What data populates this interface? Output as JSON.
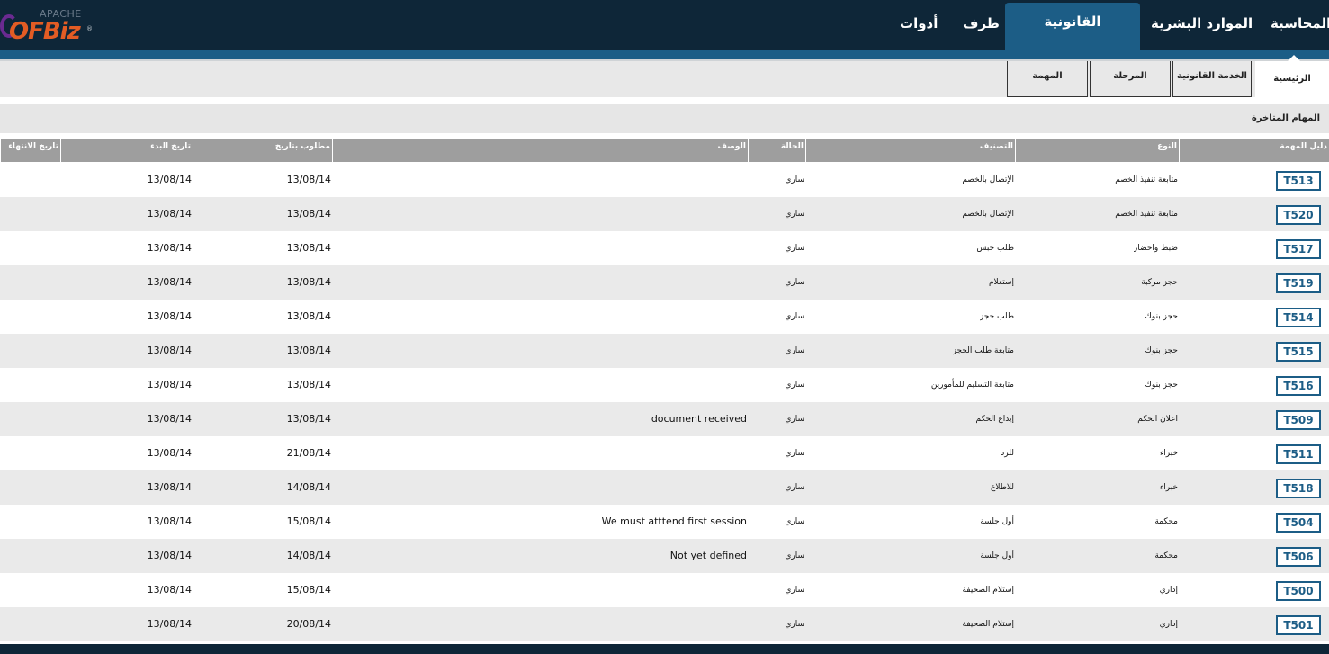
{
  "logo": {
    "top_text": "APACHE",
    "main_text": "OFBiz",
    "mark": "®"
  },
  "nav": {
    "items": [
      {
        "label": "المحاسبة",
        "active": false
      },
      {
        "label": "الموارد البشرية",
        "active": false
      },
      {
        "label": "القانونية",
        "active": true
      },
      {
        "label": "طرف",
        "active": false
      },
      {
        "label": "أدوات",
        "active": false
      }
    ]
  },
  "subtabs": [
    {
      "label": "الرئيسية",
      "active": true
    },
    {
      "label": "الخدمة القانونية",
      "active": false
    },
    {
      "label": "المرحلة",
      "active": false
    },
    {
      "label": "المهمة",
      "active": false
    }
  ],
  "panel": {
    "title": "المهام المتاخرة"
  },
  "table": {
    "headers": {
      "id": "دليل المهمة",
      "type": "النوع",
      "category": "التصنيف",
      "status": "الحالة",
      "description": "الوصف",
      "due": "مطلوب بتاريخ",
      "start": "تاريخ البدء",
      "end": "تاريخ الانتهاء"
    },
    "rows": [
      {
        "id": "T513",
        "type": "متابعة تنفيذ الخصم",
        "category": "الإتصال بالخصم",
        "status": "ساري",
        "description": "",
        "due": "13/08/14",
        "start": "13/08/14",
        "end": ""
      },
      {
        "id": "T520",
        "type": "متابعة تنفيذ الخصم",
        "category": "الإتصال بالخصم",
        "status": "ساري",
        "description": "",
        "due": "13/08/14",
        "start": "13/08/14",
        "end": ""
      },
      {
        "id": "T517",
        "type": "ضبط واحضار",
        "category": "طلب حبس",
        "status": "ساري",
        "description": "",
        "due": "13/08/14",
        "start": "13/08/14",
        "end": ""
      },
      {
        "id": "T519",
        "type": "حجز مركبة",
        "category": "إستعلام",
        "status": "ساري",
        "description": "",
        "due": "13/08/14",
        "start": "13/08/14",
        "end": ""
      },
      {
        "id": "T514",
        "type": "حجز بنوك",
        "category": "طلب حجز",
        "status": "ساري",
        "description": "",
        "due": "13/08/14",
        "start": "13/08/14",
        "end": ""
      },
      {
        "id": "T515",
        "type": "حجز بنوك",
        "category": "متابعة طلب الحجز",
        "status": "ساري",
        "description": "",
        "due": "13/08/14",
        "start": "13/08/14",
        "end": ""
      },
      {
        "id": "T516",
        "type": "حجز بنوك",
        "category": "متابعة التسليم للمأمورين",
        "status": "ساري",
        "description": "",
        "due": "13/08/14",
        "start": "13/08/14",
        "end": ""
      },
      {
        "id": "T509",
        "type": "اعلان الحكم",
        "category": "إيداع الحكم",
        "status": "ساري",
        "description": "document received",
        "due": "13/08/14",
        "start": "13/08/14",
        "end": ""
      },
      {
        "id": "T511",
        "type": "خبراء",
        "category": "للرد",
        "status": "ساري",
        "description": "",
        "due": "21/08/14",
        "start": "13/08/14",
        "end": ""
      },
      {
        "id": "T518",
        "type": "خبراء",
        "category": "للاطلاع",
        "status": "ساري",
        "description": "",
        "due": "14/08/14",
        "start": "13/08/14",
        "end": ""
      },
      {
        "id": "T504",
        "type": "محكمة",
        "category": "أول جلسة",
        "status": "ساري",
        "description": "We must atttend first session",
        "due": "15/08/14",
        "start": "13/08/14",
        "end": ""
      },
      {
        "id": "T506",
        "type": "محكمة",
        "category": "أول جلسة",
        "status": "ساري",
        "description": "Not yet defined",
        "due": "14/08/14",
        "start": "13/08/14",
        "end": ""
      },
      {
        "id": "T500",
        "type": "إداري",
        "category": "إستلام الصحيفة",
        "status": "ساري",
        "description": "",
        "due": "15/08/14",
        "start": "13/08/14",
        "end": ""
      },
      {
        "id": "T501",
        "type": "إداري",
        "category": "إستلام الصحيفة",
        "status": "ساري",
        "description": "",
        "due": "20/08/14",
        "start": "13/08/14",
        "end": ""
      }
    ]
  },
  "colors": {
    "nav_bg": "#0e2638",
    "accent": "#1c5d86",
    "header_gray": "#9e9e9e",
    "row_alt": "#eaeaea"
  }
}
